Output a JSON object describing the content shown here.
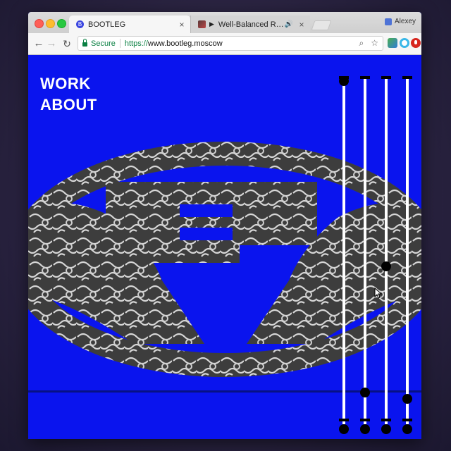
{
  "browser": {
    "tabs": [
      {
        "title": "BOOTLEG",
        "favicon": "b-icon",
        "active": true
      },
      {
        "title": "Well-Balanced Rollback",
        "favicon": "video-thumb-icon",
        "active": false,
        "playing": true
      }
    ],
    "profile_name": "Alexey",
    "address": {
      "secure_label": "Secure",
      "scheme": "https://",
      "host": "www.bootleg.moscow"
    }
  },
  "site": {
    "nav": [
      {
        "label": "WORK"
      },
      {
        "label": "ABOUT"
      }
    ],
    "background_color": "#0a14ee",
    "slider_levels": [
      0.0,
      0.94,
      0.56,
      0.96
    ]
  },
  "icons": {
    "close": "×",
    "back": "←",
    "forward": "→",
    "reload": "↻",
    "zoom": "⌕",
    "star": "☆",
    "play": "▶",
    "audio": "🔊"
  }
}
